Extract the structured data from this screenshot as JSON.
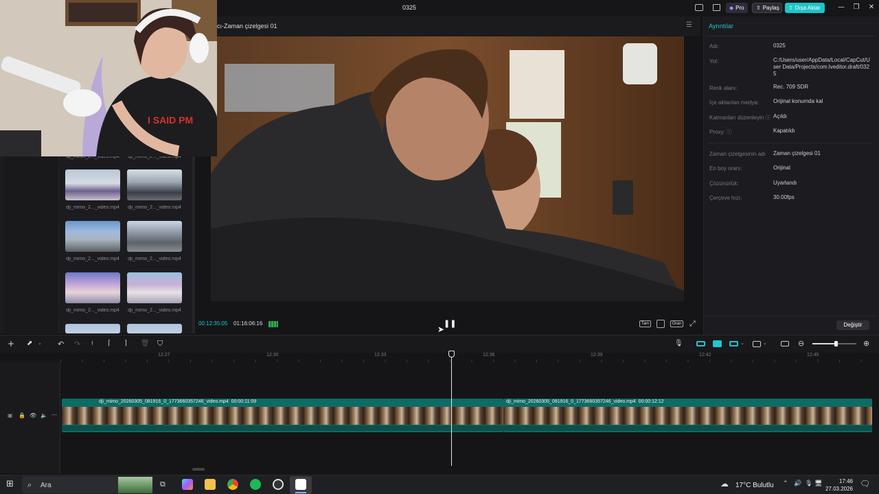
{
  "window": {
    "title": "0325"
  },
  "header": {
    "pro_label": "Pro",
    "share_label": "Paylaş",
    "export_label": "Dışa Aktar"
  },
  "player": {
    "title": "cı-Zaman çizelgesi 01",
    "current_time": "00:12:35:05",
    "total_time": "01:16:06:16",
    "fit_label": "Tam",
    "ratio_label": "Oran"
  },
  "media": {
    "items": [
      {
        "label": "dji_mimo_2..._video.mp4"
      },
      {
        "label": "dji_mimo_2..._video.mp4"
      },
      {
        "label": "dji_mimo_2..._video.mp4"
      },
      {
        "label": "dji_mimo_2..._video.mp4"
      },
      {
        "label": "dji_mimo_2..._video.mp4"
      },
      {
        "label": "dji_mimo_2..._video.mp4"
      },
      {
        "label": "dji_mimo_2..._video.mp4"
      },
      {
        "label": "dji_mimo_2..._video.mp4"
      }
    ]
  },
  "details": {
    "title": "Ayrıntılar",
    "rows": [
      {
        "label": "Adı:",
        "value": "0325"
      },
      {
        "label": "Yol:",
        "value": "C:/Users/user/AppData/Local/CapCut/User Data/Projects/com.lveditor.draft/0325"
      },
      {
        "label": "Renk alanı:",
        "value": "Rec. 709 SDR"
      },
      {
        "label": "İçe aktarılan medya:",
        "value": "Orijinal konumda kal"
      },
      {
        "label": "Katmanları düzenleyin",
        "value": "Açıldı"
      },
      {
        "label": "Proxy:",
        "value": "Kapatıldı"
      },
      {
        "label": "Zaman çizelgesinin adı",
        "value": "Zaman çizelgesi 01"
      },
      {
        "label": "En boy oranı:",
        "value": "Orijinal"
      },
      {
        "label": "Çözünürlük:",
        "value": "Uyarlandı"
      },
      {
        "label": "Çerçeve hızı:",
        "value": "30.00fps"
      }
    ],
    "edit_label": "Değiştir"
  },
  "timeline": {
    "ticks": [
      "12:27",
      "12:30",
      "12:33",
      "12:36",
      "12:39",
      "12:42",
      "12:45"
    ],
    "clips": [
      {
        "name": "dji_mimo_20260305_081916_0_1773660357246_video.mp4",
        "duration": "00:00:11:09"
      },
      {
        "name": "dji_mimo_20260305_081916_0_1773660357246_video.mp4",
        "duration": "00:00:12:12"
      }
    ]
  },
  "taskbar": {
    "search_placeholder": "Ara",
    "weather": "17°C  Bulutlu",
    "time": "17:46",
    "date": "27.03.2026"
  },
  "colors": {
    "accent": "#1ec8cf",
    "clip": "#0f6b65",
    "background": "#151518"
  }
}
